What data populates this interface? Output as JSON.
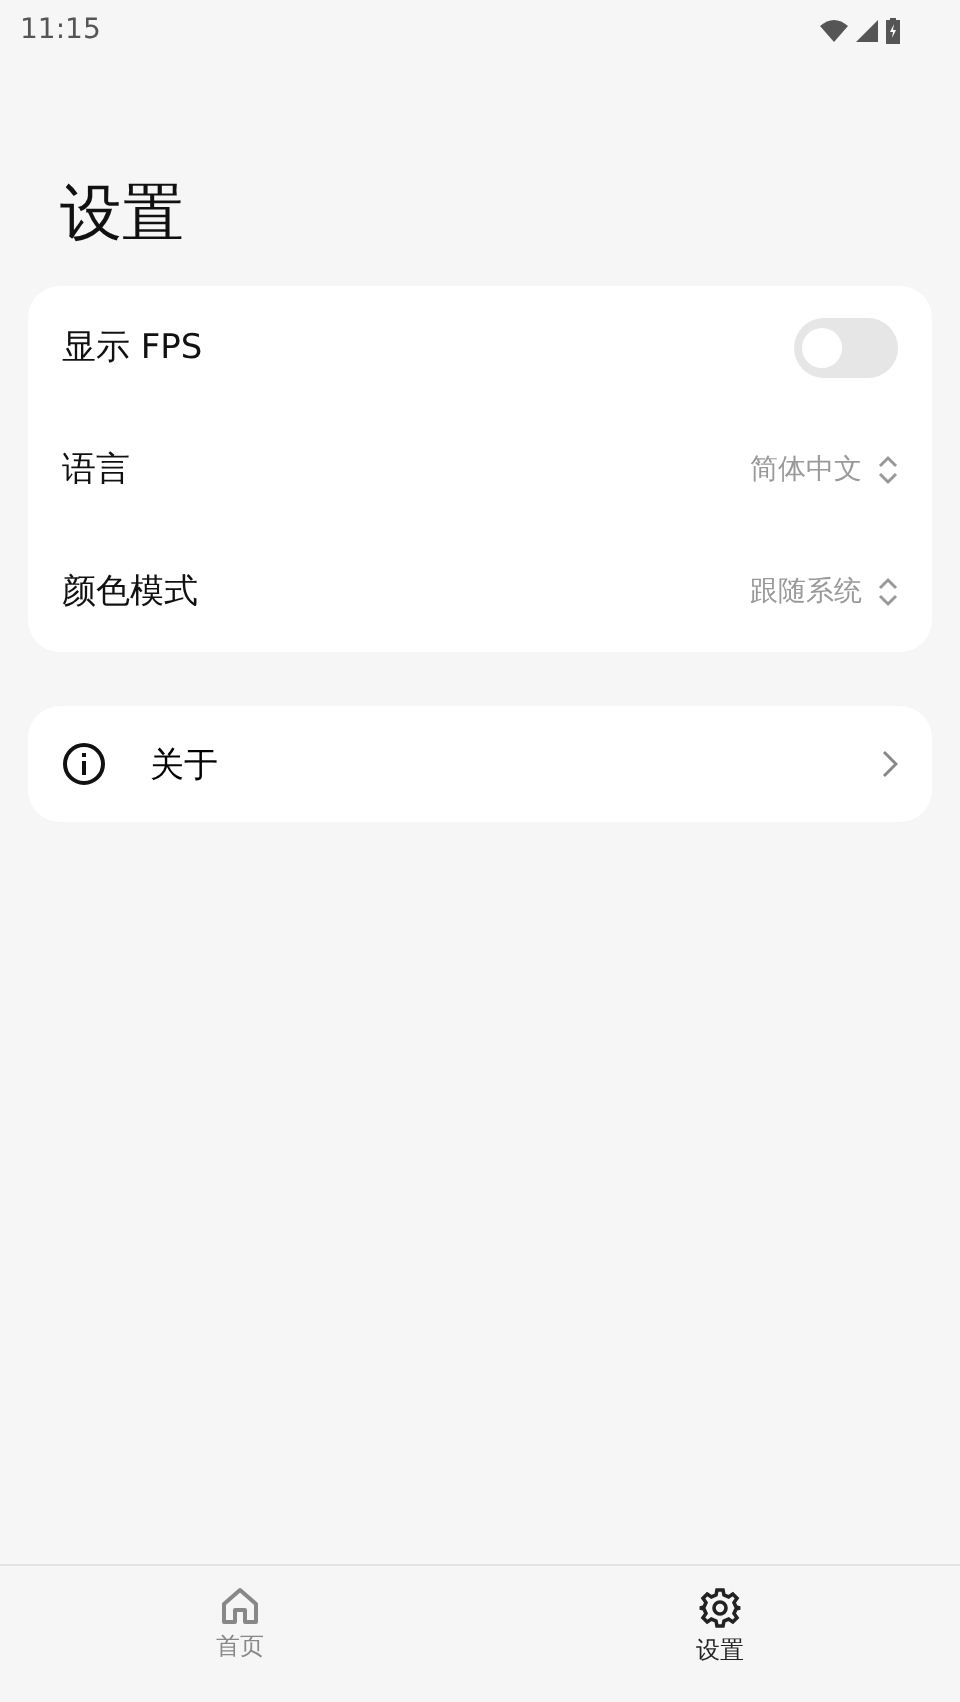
{
  "status_bar": {
    "time": "11:15"
  },
  "title": "设置",
  "settings": [
    {
      "kind": "toggle",
      "label": "显示 FPS",
      "on": false
    },
    {
      "kind": "select",
      "label": "语言",
      "value": "简体中文"
    },
    {
      "kind": "select",
      "label": "颜色模式",
      "value": "跟随系统"
    }
  ],
  "about": {
    "label": "关于"
  },
  "nav": [
    {
      "label": "首页",
      "kind": "home",
      "selected": false
    },
    {
      "label": "设置",
      "kind": "gear",
      "selected": true
    }
  ]
}
